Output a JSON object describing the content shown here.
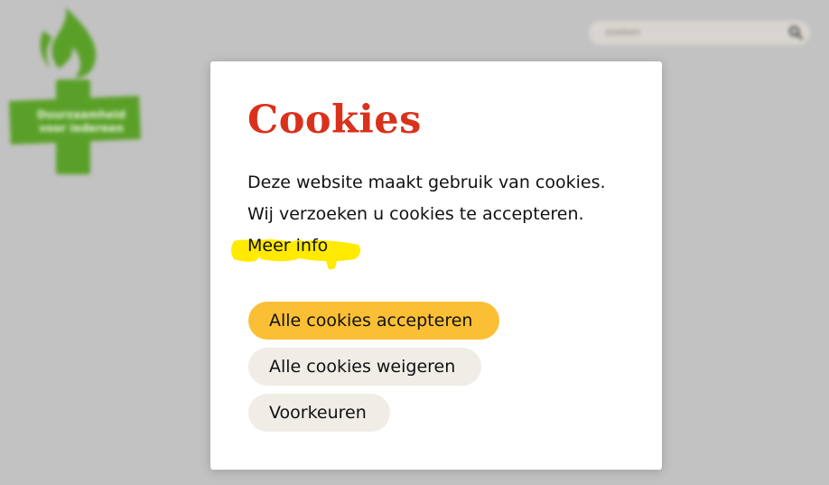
{
  "background": {
    "logo_text_line1": "Duurzaamheid",
    "logo_text_line2": "voor iedereen",
    "search": {
      "placeholder": "zoeken",
      "icon": "search-icon"
    }
  },
  "modal": {
    "title": "Cookies",
    "line1": "Deze website maakt gebruik van cookies.",
    "line2": "Wij verzoeken u cookies te accepteren.",
    "more_info": "Meer info",
    "buttons": {
      "accept": "Alle cookies accepteren",
      "reject": "Alle cookies weigeren",
      "preferences": "Voorkeuren"
    }
  },
  "colors": {
    "title": "#d9311c",
    "accept_button": "#fbbf36",
    "secondary_button": "#f0ece6",
    "highlight": "#ffea00",
    "logo_green": "#5aa028",
    "backdrop": "#c2c2c2"
  }
}
